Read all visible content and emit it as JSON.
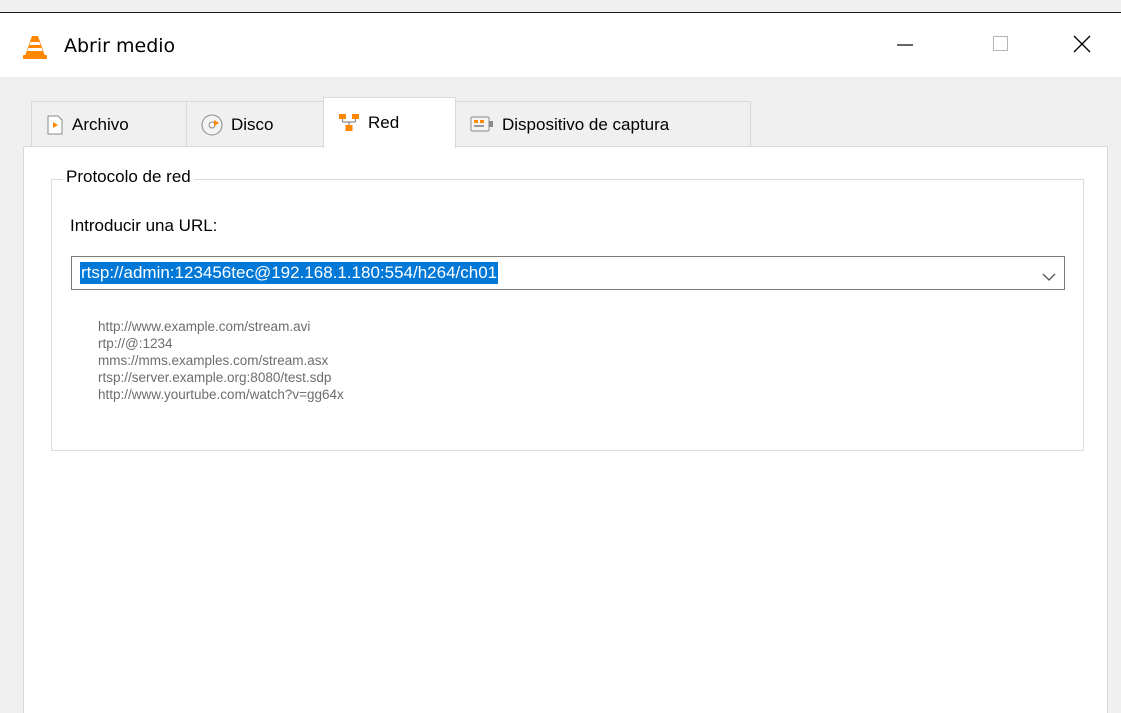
{
  "window": {
    "title": "Abrir medio",
    "icon": "vlc-cone-icon",
    "controls": [
      "minimize",
      "maximize",
      "close"
    ]
  },
  "tabs": [
    {
      "label": "Archivo",
      "icon": "file-play-icon",
      "selected": false
    },
    {
      "label": "Disco",
      "icon": "disc-icon",
      "selected": false
    },
    {
      "label": "Red",
      "icon": "network-icon",
      "selected": true
    },
    {
      "label": "Dispositivo de captura",
      "icon": "capture-device-icon",
      "selected": false
    }
  ],
  "network": {
    "group_title": "Protocolo de red",
    "url_label": "Introducir una URL:",
    "url_value": "rtsp://admin:123456tec@192.168.1.180:554/h264/ch01",
    "examples": [
      "http://www.example.com/stream.avi",
      "rtp://@:1234",
      "mms://mms.examples.com/stream.asx",
      "rtsp://server.example.org:8080/test.sdp",
      "http://www.yourtube.com/watch?v=gg64x"
    ]
  },
  "colors": {
    "selection": "#0078d7",
    "hint_text": "#6d6d6d",
    "vlc_orange": "#ff8800"
  }
}
